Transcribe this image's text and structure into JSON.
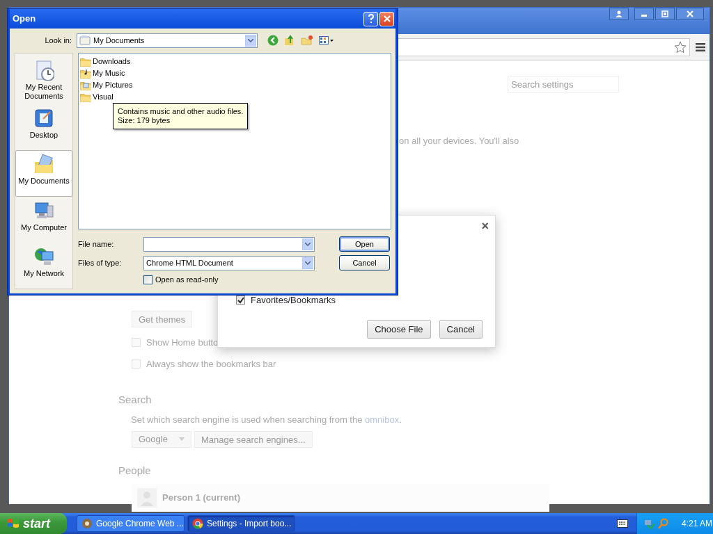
{
  "chrome_window": {
    "search_placeholder": "Search settings",
    "sync_text": "on all your devices. You'll also",
    "appearance": {
      "buttons": [
        "Get themes"
      ],
      "checkboxes": [
        {
          "label": "Show Home butto",
          "checked": false
        },
        {
          "label": "Always show the bookmarks bar",
          "checked": false
        }
      ]
    },
    "search_section": {
      "heading": "Search",
      "description": "Set which search engine is used when searching from the ",
      "link": "omnibox",
      "description_end": ".",
      "engine": "Google",
      "manage_button": "Manage search engines..."
    },
    "people": {
      "heading": "People",
      "person": "Person 1 (current)"
    }
  },
  "import_dialog": {
    "close": "×",
    "options": [
      {
        "label": "Favorites/Bookmarks",
        "checked": true
      }
    ],
    "buttons": [
      "Choose File",
      "Cancel"
    ]
  },
  "open_dialog": {
    "title": "Open",
    "look_in_label": "Look in:",
    "look_in": "My Documents",
    "places": [
      {
        "label": "My Recent Documents",
        "kind": "recent",
        "selected": false
      },
      {
        "label": "Desktop",
        "kind": "desktop",
        "selected": false
      },
      {
        "label": "My Documents",
        "kind": "documents",
        "selected": true
      },
      {
        "label": "My Computer",
        "kind": "computer",
        "selected": false
      },
      {
        "label": "My Network",
        "kind": "network",
        "selected": false
      }
    ],
    "files": [
      {
        "name": "Downloads",
        "kind": "folder"
      },
      {
        "name": "My Music",
        "kind": "music"
      },
      {
        "name": "My Pictures",
        "kind": "pictures"
      },
      {
        "name": "Visual",
        "kind": "folder"
      }
    ],
    "tooltip": [
      "Contains music and other audio files.",
      "Size: 179 bytes"
    ],
    "file_name_label": "File name:",
    "file_type_label": "Files of type:",
    "file_type": "Chrome HTML Document",
    "read_only": {
      "label": "Open as read-only",
      "checked": false
    },
    "buttons": [
      {
        "label": "Open",
        "default": true
      },
      {
        "label": "Cancel",
        "default": false
      }
    ]
  },
  "taskbar": {
    "start": "start",
    "tasks": [
      {
        "label": "Google Chrome Web ...",
        "kind": "app",
        "selected": false
      },
      {
        "label": "Settings - Import boo...",
        "kind": "chrome",
        "selected": true
      }
    ],
    "clock": "4:21 AM"
  }
}
